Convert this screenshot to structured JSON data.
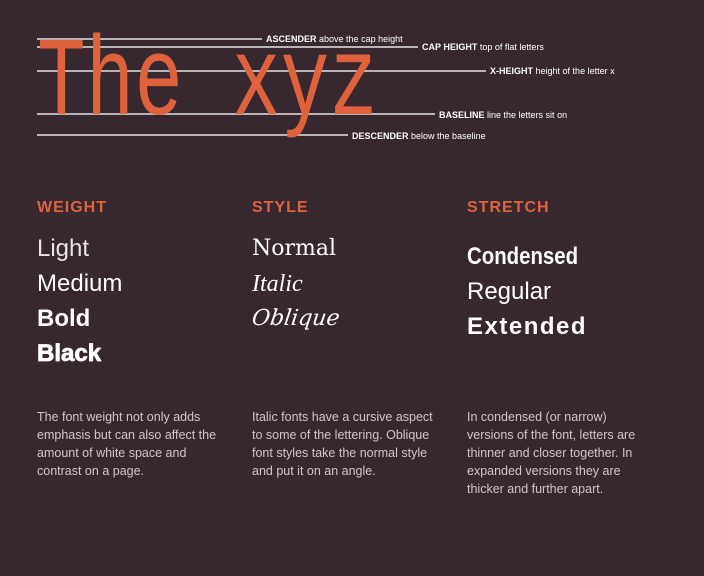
{
  "specimen": "The xyz",
  "metrics": [
    {
      "term": "ASCENDER",
      "desc": "above the cap height"
    },
    {
      "term": "CAP HEIGHT",
      "desc": "top of flat letters"
    },
    {
      "term": "X-HEIGHT",
      "desc": "height of the letter x"
    },
    {
      "term": "BASELINE",
      "desc": "line the letters sit on"
    },
    {
      "term": "DESCENDER",
      "desc": "below the baseline"
    }
  ],
  "columns": [
    {
      "heading": "WEIGHT",
      "samples": [
        "Light",
        "Medium",
        "Bold",
        "Black"
      ],
      "text": "The font weight not only adds emphasis but can also affect the amount of white space and contrast on a page."
    },
    {
      "heading": "STYLE",
      "samples": [
        "Normal",
        "Italic",
        "Oblique"
      ],
      "text": "Italic fonts have a cursive aspect to some of the lettering. Oblique font styles take the normal style and put it on an angle."
    },
    {
      "heading": "STRETCH",
      "samples": [
        "Condensed",
        "Regular",
        "Extended"
      ],
      "text": "In condensed (or narrow) versions of the font, letters are thinner and closer together. In expanded versions they are thicker and further apart."
    }
  ],
  "colors": {
    "background": "#372830",
    "accent": "#e0623c"
  }
}
